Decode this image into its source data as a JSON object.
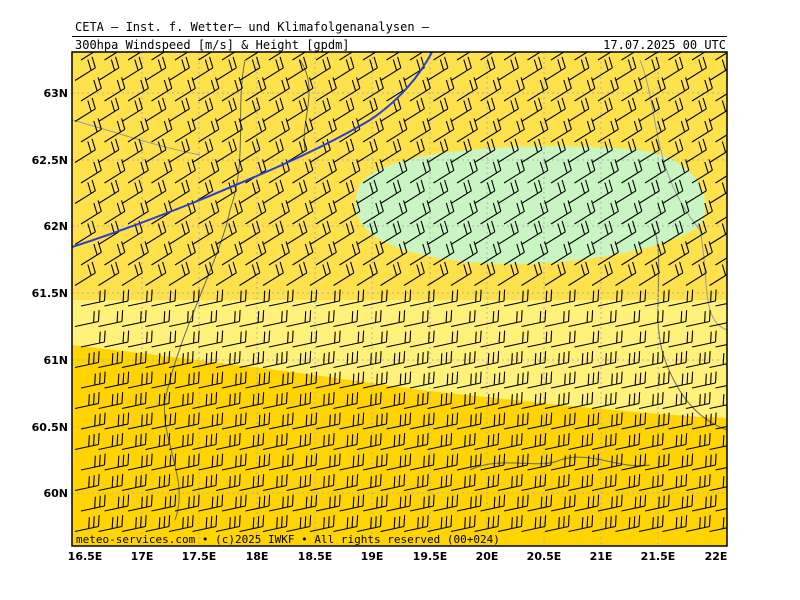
{
  "header": {
    "title": "CETA — Inst. f. Wetter— und Klimafolgenanalysen —",
    "subtitle": "300hpa_Windspeed_[m/s]_&_Height_[gpdm]",
    "datetime": "17.07.2025 00 UTC"
  },
  "map": {
    "lat_labels": [
      "63N",
      "62.5N",
      "62N",
      "61.5N",
      "61N",
      "60.5N",
      "60N"
    ],
    "lon_labels": [
      "16.5E",
      "17E",
      "17.5E",
      "18E",
      "18.5E",
      "19E",
      "19.5E",
      "20E",
      "20.5E",
      "21E",
      "21.5E",
      "22E"
    ],
    "footer": "meteo-services.com • (c)2025 IWKF • All rights reserved (00+024)",
    "colors": {
      "band_light": "#fff17a",
      "band_yellow": "#ffe14c",
      "band_dark": "#ffd400",
      "band_green": "#c8f5c2",
      "height_contour": "#2a3fd0",
      "grid": "#b0b0b0",
      "barb": "#000000"
    }
  }
}
